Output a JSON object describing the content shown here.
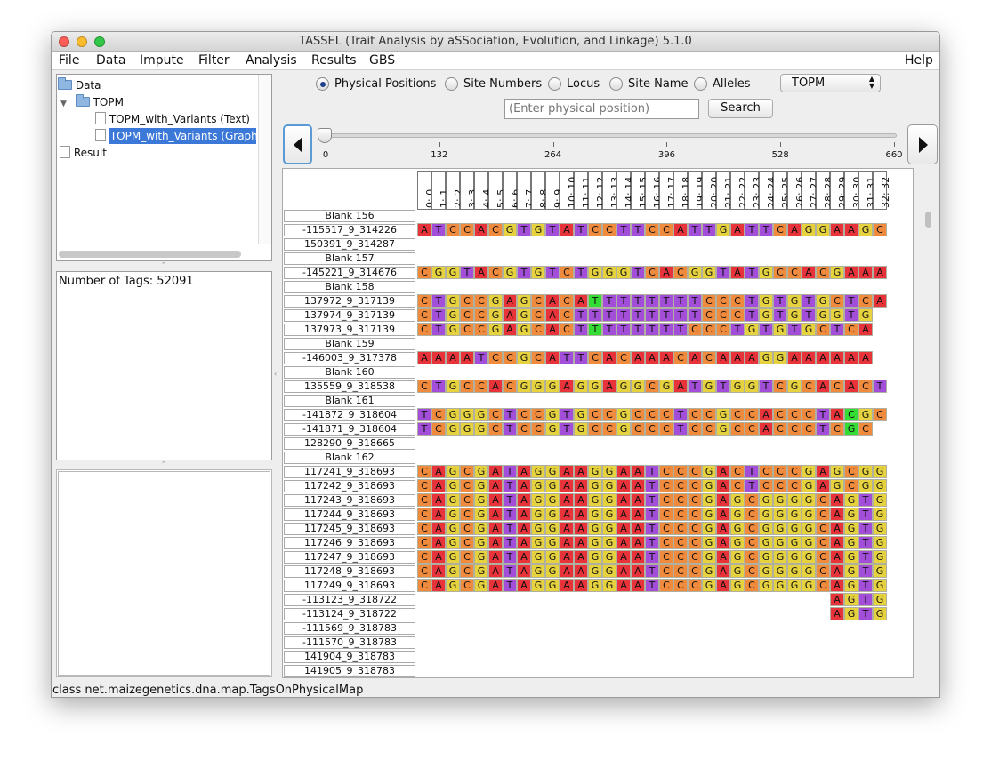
{
  "window": {
    "title": "TASSEL (Trait Analysis by aSSociation, Evolution, and Linkage) 5.1.0"
  },
  "menu": {
    "items": [
      "File",
      "Data",
      "Impute",
      "Filter",
      "Analysis",
      "Results",
      "GBS"
    ],
    "help": "Help"
  },
  "tree": {
    "data_label": "Data",
    "topm_label": "TOPM",
    "item_text": "TOPM_with_Variants (Text)",
    "item_graphic": "TOPM_with_Variants (Graphic",
    "result_label": "Result"
  },
  "info": {
    "text": "Number of Tags: 52091"
  },
  "view_options": {
    "radios": [
      "Physical Positions",
      "Site Numbers",
      "Locus",
      "Site Name",
      "Alleles"
    ],
    "selected": "Physical Positions",
    "combo_value": "TOPM"
  },
  "search": {
    "placeholder": "(Enter physical position)",
    "button": "Search"
  },
  "slider": {
    "ticks": [
      "0",
      "132",
      "264",
      "396",
      "528",
      "660"
    ],
    "value": 0,
    "max": 660
  },
  "columns": [
    "0: 0",
    "1: 1",
    "2: 2",
    "3: 3",
    "4: 4",
    "5: 5",
    "6: 6",
    "7: 7",
    "8: 8",
    "9: 9",
    "10: 10",
    "11: 11",
    "12: 12",
    "13: 13",
    "14: 14",
    "15: 15",
    "16: 16",
    "17: 17",
    "18: 18",
    "19: 19",
    "20: 20",
    "21: 21",
    "22: 22",
    "23: 23",
    "24: 24",
    "25: 25",
    "26: 26",
    "27: 27",
    "28: 28",
    "29: 29",
    "30: 30",
    "31: 31",
    "32: 32"
  ],
  "rows": [
    {
      "label": "Blank 156",
      "seq": ""
    },
    {
      "label": "-115517_9_314226",
      "seq": "ATCCACGTGTATCCTTCCATTGATTCAGGAAGC"
    },
    {
      "label": "150391_9_314287",
      "seq": ""
    },
    {
      "label": "Blank 157",
      "seq": ""
    },
    {
      "label": "-145221_9_314676",
      "seq": "CGGTACGTGTCTGGGTCACGGTATGCCACGAAA"
    },
    {
      "label": "Blank 158",
      "seq": ""
    },
    {
      "label": "137972_9_317139",
      "seq": "CTGCCGAGCACATTTTTTTTCCCTGTGTGCTCA"
    },
    {
      "label": "137974_9_317139",
      "seq": "CTGCCGAGCACTTTTTTTTTCCCTGTGTGGTG"
    },
    {
      "label": "137973_9_317139",
      "seq": "CTGCCGAGCACTTTTTTTTCCCTGTGTGCTCA"
    },
    {
      "label": "Blank 159",
      "seq": ""
    },
    {
      "label": "-146003_9_317378",
      "seq": "AAAATCCGCATTCACAAACACAAAGGAAAAAA"
    },
    {
      "label": "Blank 160",
      "seq": ""
    },
    {
      "label": "135559_9_318538",
      "seq": "CTGCCACGGGAGGAGGCGATGTGGTCGCACACT"
    },
    {
      "label": "Blank 161",
      "seq": ""
    },
    {
      "label": "-141872_9_318604",
      "seq": "TCGGGCTCCGTGCCGCCCTCCGCCACCCTACGC"
    },
    {
      "label": "-141871_9_318604",
      "seq": "TCGGGCTCCGTGCCGCCCTCCGCCACCCTCGC"
    },
    {
      "label": "128290_9_318665",
      "seq": ""
    },
    {
      "label": "Blank 162",
      "seq": ""
    },
    {
      "label": "117241_9_318693",
      "seq": "CAGCGATAGGAAGGAATCCCGACTCCCGAGCGG"
    },
    {
      "label": "117242_9_318693",
      "seq": "CAGCGATAGGAAGGAATCCCGACTCCCGAGCGG"
    },
    {
      "label": "117243_9_318693",
      "seq": "CAGCGATAGGAAGGAATCCCGAGCGGGGCAGTG"
    },
    {
      "label": "117244_9_318693",
      "seq": "CAGCGATAGGAAGGAATCCCGAGCGGGGCAGTG"
    },
    {
      "label": "117245_9_318693",
      "seq": "CAGCGATAGGAAGGAATCCCGAGCGGGGCAGTG"
    },
    {
      "label": "117246_9_318693",
      "seq": "CAGCGATAGGAAGGAATCCCGAGCGGGGCAGTG"
    },
    {
      "label": "117247_9_318693",
      "seq": "CAGCGATAGGAAGGAATCCCGAGCGGGGCAGTG"
    },
    {
      "label": "117248_9_318693",
      "seq": "CAGCGATAGGAAGGAATCCCGAGCGGGGCAGTG"
    },
    {
      "label": "117249_9_318693",
      "seq": "CAGCGATAGGAAGGAATCCCGAGCGGGGCAGTG"
    },
    {
      "label": "-113123_9_318722",
      "seq": "AGTG",
      "offset": 29
    },
    {
      "label": "-113124_9_318722",
      "seq": "AGTG",
      "offset": 29
    },
    {
      "label": "-111569_9_318783",
      "seq": ""
    },
    {
      "label": "-111570_9_318783",
      "seq": ""
    },
    {
      "label": "141904_9_318783",
      "seq": ""
    },
    {
      "label": "141905_9_318783",
      "seq": ""
    }
  ],
  "base_colors": {
    "A": "#e8333a",
    "C": "#f08a3c",
    "G": "#e6d23e",
    "T": "#a24ed9",
    "TN": "#33dd33"
  },
  "highlight_t": [
    [
      6,
      12
    ],
    [
      8,
      12
    ]
  ],
  "highlight_c": [
    [
      15,
      30
    ]
  ],
  "highlight_a": [
    [
      14,
      30
    ]
  ],
  "status": {
    "text": "class net.maizegenetics.dna.map.TagsOnPhysicalMap"
  }
}
